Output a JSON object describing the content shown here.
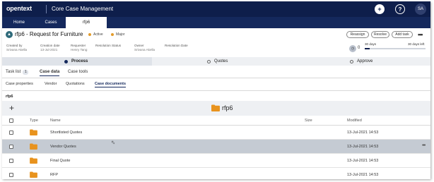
{
  "brand": {
    "logo": "opentext",
    "app_title": "Core Case Management",
    "user_initials": "SA"
  },
  "top_icons": [
    "add-icon",
    "help-icon",
    "user-avatar"
  ],
  "tabs": [
    {
      "label": "Home",
      "active": false
    },
    {
      "label": "Cases",
      "active": false
    },
    {
      "label": "rfp6",
      "active": true
    }
  ],
  "case": {
    "title": "rfp6 - Request for Furniture",
    "status": "Active",
    "priority": "Major",
    "status_color": "#e39b2a",
    "actions": {
      "reassign": "Reassign",
      "resolve": "Resolve",
      "add_task": "Add task",
      "more": "•••"
    },
    "meta": [
      {
        "key": "Created by",
        "value": "Srivana Akella"
      },
      {
        "key": "Creation date",
        "value": "13-Jul-2021"
      },
      {
        "key": "Requester",
        "value": "Henry Tang"
      },
      {
        "key": "Resolution Status",
        "value": ""
      },
      {
        "key": "Owner",
        "value": "Srivana Akella"
      },
      {
        "key": "Resolution Date",
        "value": ""
      }
    ],
    "sla": {
      "count": "0",
      "start_label": "30 days",
      "end_label": "30 days left",
      "progress": 0.08
    }
  },
  "stepper": [
    {
      "label": "Process",
      "active": true
    },
    {
      "label": "Quotes",
      "active": false
    },
    {
      "label": "Approve",
      "active": false
    }
  ],
  "main_tabs": {
    "task_list": "Task list",
    "task_count": "1",
    "case_data": "Case data",
    "case_tools": "Case tools"
  },
  "sub_tabs": {
    "case_properties": "Case properties",
    "vendor": "Vendor",
    "quotations": "Quotations",
    "case_documents": "Case documents"
  },
  "breadcrumb": "rfp6",
  "folder": {
    "name": "rfp6",
    "folder_color": "#e8931e"
  },
  "table": {
    "headers": {
      "type": "Type",
      "name": "Name",
      "size": "Size",
      "modified": "Modified"
    },
    "rows": [
      {
        "name": "Shortlisted Quotes",
        "size": "",
        "modified": "13-Jul-2021 14:53",
        "selected": false
      },
      {
        "name": "Vendor Quotes",
        "size": "",
        "modified": "13-Jul-2021 14:53",
        "selected": true
      },
      {
        "name": "Final Quote",
        "size": "",
        "modified": "13-Jul-2021 14:53",
        "selected": false
      },
      {
        "name": "RFP",
        "size": "",
        "modified": "13-Jul-2021 14:53",
        "selected": false
      }
    ]
  }
}
